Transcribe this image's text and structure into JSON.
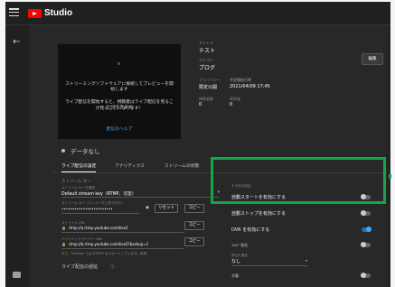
{
  "app": {
    "brand": "Studio"
  },
  "preview": {
    "line1": "ストリーミングソフトウェアに接続してプレビューを開始します",
    "line2": "ライブ配信を開始すると、視聴者はライブ配信を見ることができます",
    "line3": "が見ることになります！",
    "help_link": "配信のヘルプ"
  },
  "stream_info": {
    "title_label": "タイトル",
    "title": "テスト",
    "category_label": "カテゴリ",
    "category": "ブログ",
    "privacy_label": "プライバシー",
    "privacy": "限定公開",
    "schedule_label": "予定開始日時",
    "schedule": "2021/04/09 17:45",
    "viewers_label": "視聴者数",
    "viewers": "0",
    "likes_label": "高評価",
    "likes": "0",
    "edit_button": "編集"
  },
  "status": {
    "text": "データなし"
  },
  "tabs": [
    "ライブ配信の設定",
    "アナリティクス",
    "ストリームの状態"
  ],
  "stream_key": {
    "section_title": "ストリーム キー",
    "select_label": "ストリーム キーを選択",
    "select_value": "Default stream key（RTMP、可変）",
    "key_label": "ストリーム キー（エンコーダに貼り付け）",
    "key_value": "••••••••••••••••••••••••",
    "reset_button": "リセット",
    "copy_button": "コピー",
    "url_label": "ストリーム URL",
    "url_value": "rtmp://a.rtmp.youtube.com/live2",
    "backup_label": "バックアップ サーバー URL",
    "backup_value": "rtmp://b.rtmp.youtube.com/live2?backup=1",
    "note_text": "また、YouTube では RTMPS をサポートしています。詳細",
    "note_link": "詳細",
    "latency_label": "ライブ配信の遅延"
  },
  "settings": {
    "section_title": "その他の設定",
    "auto_start": "自動スタートを有効にする",
    "auto_stop": "自動ストップを有効にする",
    "dvr": "DVR を有効にする",
    "three_sixty": "360° 動画",
    "dropdown_label": "再生の遅延",
    "dropdown_value": "なし",
    "subtitles": "字幕"
  },
  "toggles": {
    "auto_start": false,
    "auto_stop": false,
    "dvr": true,
    "three_sixty": false,
    "subtitles": false
  },
  "colors": {
    "brand_red": "#ff0000",
    "accent_blue": "#3ea6ff",
    "highlight_green": "#17a34a"
  }
}
